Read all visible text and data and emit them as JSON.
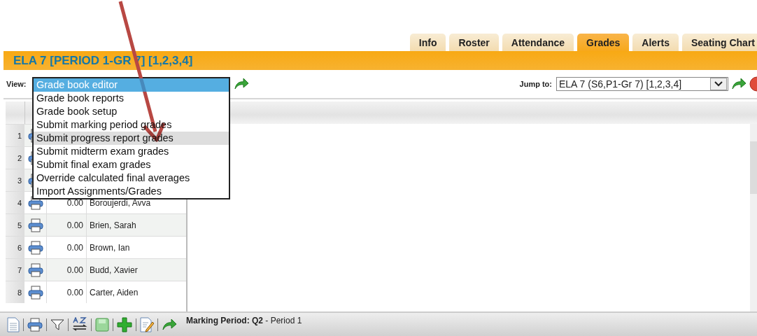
{
  "tabs": [
    {
      "label": "Info",
      "selected": false
    },
    {
      "label": "Roster",
      "selected": false
    },
    {
      "label": "Attendance",
      "selected": false
    },
    {
      "label": "Grades",
      "selected": true
    },
    {
      "label": "Alerts",
      "selected": false
    },
    {
      "label": "Seating Chart",
      "selected": false
    }
  ],
  "header": {
    "title": "ELA 7 [PERIOD 1-GR 7] [1,2,3,4]"
  },
  "view": {
    "label": "View:",
    "options": [
      {
        "label": "Grade book editor",
        "selected": true,
        "hovered": false
      },
      {
        "label": "Grade book reports",
        "selected": false,
        "hovered": false
      },
      {
        "label": "Grade book setup",
        "selected": false,
        "hovered": false
      },
      {
        "label": "Submit marking period grades",
        "selected": false,
        "hovered": false
      },
      {
        "label": "Submit progress report grades",
        "selected": false,
        "hovered": true
      },
      {
        "label": "Submit midterm exam grades",
        "selected": false,
        "hovered": false
      },
      {
        "label": "Submit final exam grades",
        "selected": false,
        "hovered": false
      },
      {
        "label": "Override calculated final averages",
        "selected": false,
        "hovered": false
      },
      {
        "label": "Import Assignments/Grades",
        "selected": false,
        "hovered": false
      }
    ]
  },
  "jump_to": {
    "label": "Jump to:",
    "value": "ELA 7 (S6,P1-Gr 7) [1,2,3,4]"
  },
  "table": {
    "rows": [
      {
        "number": "1"
      },
      {
        "number": "2"
      },
      {
        "number": "3"
      },
      {
        "number": "4",
        "score": "0.00",
        "name": "Boroujerdi, Avva"
      },
      {
        "number": "5",
        "score": "0.00",
        "name": "Brien, Sarah"
      },
      {
        "number": "6",
        "score": "0.00",
        "name": "Brown, Ian"
      },
      {
        "number": "7",
        "score": "0.00",
        "name": "Budd, Xavier"
      },
      {
        "number": "8",
        "score": "0.00",
        "name": "Carter, Aiden"
      }
    ]
  },
  "status_bar": {
    "text": "**Marking Period: Q2** - Period 1"
  }
}
